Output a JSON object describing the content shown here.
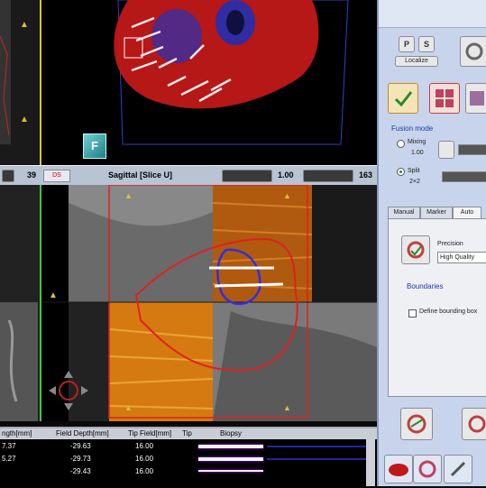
{
  "top_view": {
    "left_num": "39",
    "orient_marker": "F"
  },
  "view_bar": {
    "left_value": "39",
    "view_tag": "DS",
    "title": "Sagittal [Slice U]",
    "value_1": "1.00",
    "value_2": "163"
  },
  "table": {
    "headers": [
      "ngth[mm]",
      "Field Depth[mm]",
      "Tip Field[mm]",
      "Tip",
      "Biopsy"
    ],
    "rows": [
      {
        "length": "7.37",
        "depth": "-29.63",
        "tip_field": "16.00"
      },
      {
        "length": "5.27",
        "depth": "-29.73",
        "tip_field": "16.00"
      },
      {
        "length": "",
        "depth": "-29.43",
        "tip_field": "16.00"
      }
    ]
  },
  "right_panel": {
    "small_btn_1": "P",
    "small_btn_2": "S",
    "small_caption": "Localize",
    "fusion_mode_label": "Fusion mode",
    "mixing_label": "Mixing",
    "mixing_value": "1.00",
    "split_label": "Split",
    "split_value": "2×2",
    "tabs": [
      "Manual",
      "Marker",
      "Auto"
    ],
    "precision_label": "Precision",
    "precision_value": "High Quality",
    "boundaries_label": "Boundaries",
    "bounding_box_label": "Define bounding box"
  },
  "colors": {
    "accent_yellow": "#d8c23a",
    "accent_green": "#3ec83e",
    "panel_bg": "#c8d4ec",
    "contour_red": "#e02020"
  }
}
